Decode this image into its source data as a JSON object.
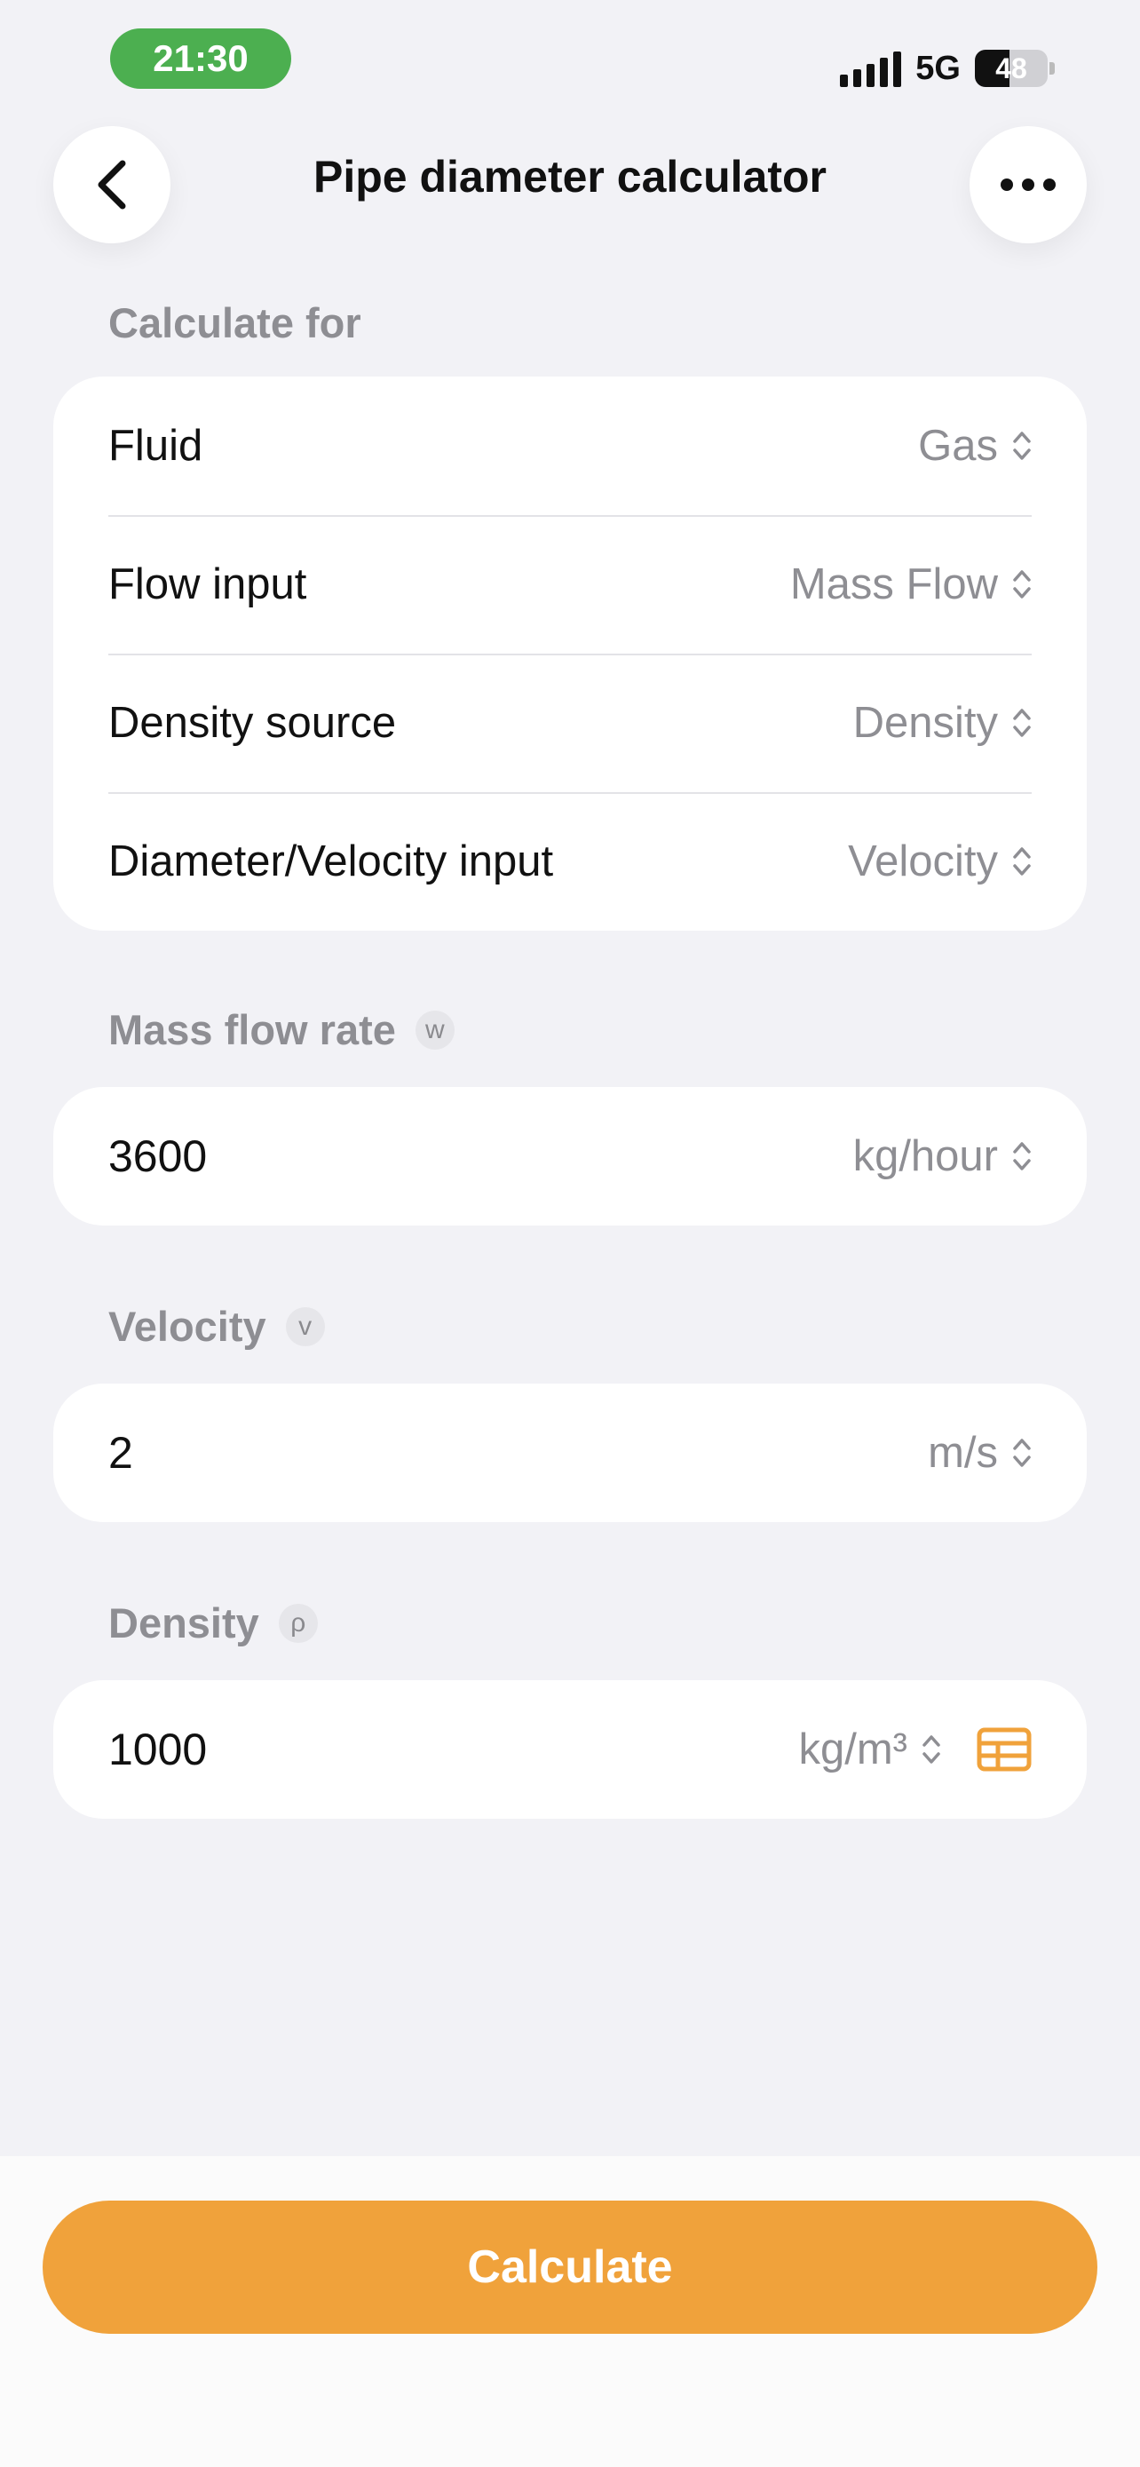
{
  "status_bar": {
    "time": "21:30",
    "network": "5G",
    "battery": "48"
  },
  "nav": {
    "title": "Pipe diameter calculator"
  },
  "calculate_for": {
    "label": "Calculate for",
    "rows": [
      {
        "label": "Fluid",
        "value": "Gas"
      },
      {
        "label": "Flow input",
        "value": "Mass Flow"
      },
      {
        "label": "Density source",
        "value": "Density"
      },
      {
        "label": "Diameter/Velocity input",
        "value": "Velocity"
      }
    ]
  },
  "mass_flow": {
    "label": "Mass flow rate",
    "symbol": "w",
    "value": "3600",
    "unit": "kg/hour"
  },
  "velocity": {
    "label": "Velocity",
    "symbol": "v",
    "value": "2",
    "unit": "m/s"
  },
  "density": {
    "label": "Density",
    "symbol": "ρ",
    "value": "1000",
    "unit": "kg/m³"
  },
  "calculate_button": {
    "label": "Calculate"
  },
  "colors": {
    "accent": "#f0a23b",
    "status_time_bg": "#4caf50",
    "background": "#f2f2f6"
  },
  "icons": {
    "back": "chevron-left-icon",
    "more": "ellipsis-icon",
    "selector": "chevron-updown-icon",
    "density_table": "table-icon"
  }
}
